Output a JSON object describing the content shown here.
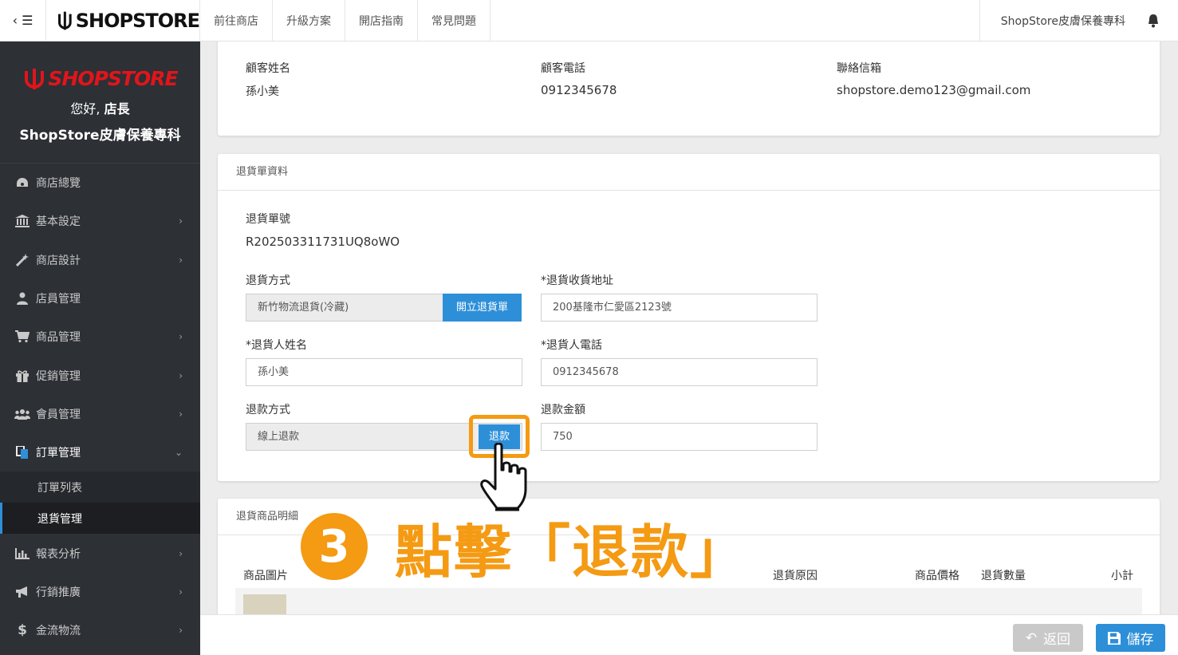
{
  "topbar": {
    "logo_text": "SHOPSTORE",
    "nav": [
      "前往商店",
      "升級方案",
      "開店指南",
      "常見問題"
    ],
    "store_name": "ShopStore皮膚保養專科"
  },
  "sidebar": {
    "logo_text": "SHOPSTORE",
    "greeting_prefix": "您好, ",
    "greeting_role": "店長",
    "store": "ShopStore皮膚保養專科",
    "items": [
      {
        "label": "商店總覽",
        "icon": "dashboard-icon"
      },
      {
        "label": "基本設定",
        "icon": "bank-icon"
      },
      {
        "label": "商店設計",
        "icon": "magic-wand-icon"
      },
      {
        "label": "店員管理",
        "icon": "staff-icon"
      },
      {
        "label": "商品管理",
        "icon": "cart-icon"
      },
      {
        "label": "促銷管理",
        "icon": "gift-icon"
      },
      {
        "label": "會員管理",
        "icon": "users-icon"
      },
      {
        "label": "訂單管理",
        "icon": "orders-icon"
      }
    ],
    "sub_items": [
      "訂單列表",
      "退貨管理"
    ],
    "items_after": [
      {
        "label": "報表分析",
        "icon": "bar-chart-icon"
      },
      {
        "label": "行銷推廣",
        "icon": "bullhorn-icon"
      },
      {
        "label": "金流物流",
        "icon": "dollar-icon"
      }
    ]
  },
  "customer": {
    "name_label": "顧客姓名",
    "name": "孫小美",
    "phone_label": "顧客電話",
    "phone": "0912345678",
    "email_label": "聯絡信箱",
    "email": "shopstore.demo123@gmail.com"
  },
  "return_info": {
    "title": "退貨單資料",
    "number_label": "退貨單號",
    "number": "R202503311731UQ8oWO",
    "method_label": "退貨方式",
    "method_value": "新竹物流退貨(冷藏)",
    "create_button": "開立退貨單",
    "address_label": "*退貨收貨地址",
    "address_value": "200基隆市仁愛區2123號",
    "person_label": "*退貨人姓名",
    "person_value": "孫小美",
    "person_phone_label": "*退貨人電話",
    "person_phone_value": "0912345678",
    "refund_method_label": "退款方式",
    "refund_method_value": "線上退款",
    "refund_button": "退款",
    "refund_amount_label": "退款金額",
    "refund_amount_value": "750"
  },
  "return_items": {
    "title": "退貨商品明細",
    "columns": [
      "商品圖片",
      "退貨原因",
      "商品價格",
      "退貨數量",
      "小計"
    ]
  },
  "footer": {
    "back_label": "返回",
    "save_label": "儲存"
  },
  "annotation": {
    "number": "3",
    "text": "點擊「退款」",
    "color": "#f49a13"
  }
}
